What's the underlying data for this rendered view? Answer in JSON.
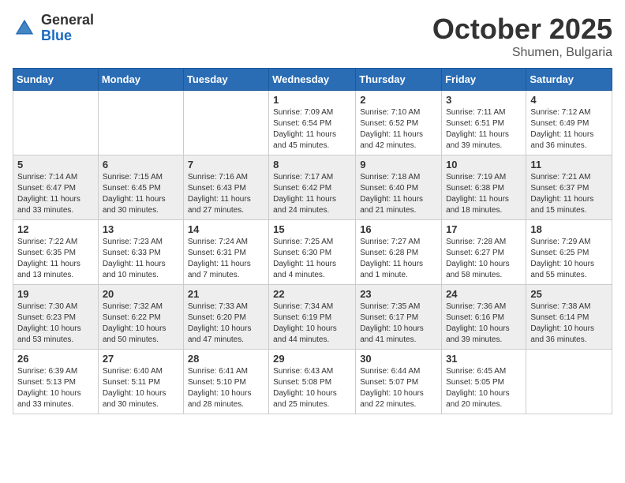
{
  "header": {
    "logo_general": "General",
    "logo_blue": "Blue",
    "month": "October 2025",
    "location": "Shumen, Bulgaria"
  },
  "days_of_week": [
    "Sunday",
    "Monday",
    "Tuesday",
    "Wednesday",
    "Thursday",
    "Friday",
    "Saturday"
  ],
  "weeks": [
    {
      "days": [
        {
          "number": "",
          "info": ""
        },
        {
          "number": "",
          "info": ""
        },
        {
          "number": "",
          "info": ""
        },
        {
          "number": "1",
          "info": "Sunrise: 7:09 AM\nSunset: 6:54 PM\nDaylight: 11 hours and 45 minutes."
        },
        {
          "number": "2",
          "info": "Sunrise: 7:10 AM\nSunset: 6:52 PM\nDaylight: 11 hours and 42 minutes."
        },
        {
          "number": "3",
          "info": "Sunrise: 7:11 AM\nSunset: 6:51 PM\nDaylight: 11 hours and 39 minutes."
        },
        {
          "number": "4",
          "info": "Sunrise: 7:12 AM\nSunset: 6:49 PM\nDaylight: 11 hours and 36 minutes."
        }
      ]
    },
    {
      "days": [
        {
          "number": "5",
          "info": "Sunrise: 7:14 AM\nSunset: 6:47 PM\nDaylight: 11 hours and 33 minutes."
        },
        {
          "number": "6",
          "info": "Sunrise: 7:15 AM\nSunset: 6:45 PM\nDaylight: 11 hours and 30 minutes."
        },
        {
          "number": "7",
          "info": "Sunrise: 7:16 AM\nSunset: 6:43 PM\nDaylight: 11 hours and 27 minutes."
        },
        {
          "number": "8",
          "info": "Sunrise: 7:17 AM\nSunset: 6:42 PM\nDaylight: 11 hours and 24 minutes."
        },
        {
          "number": "9",
          "info": "Sunrise: 7:18 AM\nSunset: 6:40 PM\nDaylight: 11 hours and 21 minutes."
        },
        {
          "number": "10",
          "info": "Sunrise: 7:19 AM\nSunset: 6:38 PM\nDaylight: 11 hours and 18 minutes."
        },
        {
          "number": "11",
          "info": "Sunrise: 7:21 AM\nSunset: 6:37 PM\nDaylight: 11 hours and 15 minutes."
        }
      ]
    },
    {
      "days": [
        {
          "number": "12",
          "info": "Sunrise: 7:22 AM\nSunset: 6:35 PM\nDaylight: 11 hours and 13 minutes."
        },
        {
          "number": "13",
          "info": "Sunrise: 7:23 AM\nSunset: 6:33 PM\nDaylight: 11 hours and 10 minutes."
        },
        {
          "number": "14",
          "info": "Sunrise: 7:24 AM\nSunset: 6:31 PM\nDaylight: 11 hours and 7 minutes."
        },
        {
          "number": "15",
          "info": "Sunrise: 7:25 AM\nSunset: 6:30 PM\nDaylight: 11 hours and 4 minutes."
        },
        {
          "number": "16",
          "info": "Sunrise: 7:27 AM\nSunset: 6:28 PM\nDaylight: 11 hours and 1 minute."
        },
        {
          "number": "17",
          "info": "Sunrise: 7:28 AM\nSunset: 6:27 PM\nDaylight: 10 hours and 58 minutes."
        },
        {
          "number": "18",
          "info": "Sunrise: 7:29 AM\nSunset: 6:25 PM\nDaylight: 10 hours and 55 minutes."
        }
      ]
    },
    {
      "days": [
        {
          "number": "19",
          "info": "Sunrise: 7:30 AM\nSunset: 6:23 PM\nDaylight: 10 hours and 53 minutes."
        },
        {
          "number": "20",
          "info": "Sunrise: 7:32 AM\nSunset: 6:22 PM\nDaylight: 10 hours and 50 minutes."
        },
        {
          "number": "21",
          "info": "Sunrise: 7:33 AM\nSunset: 6:20 PM\nDaylight: 10 hours and 47 minutes."
        },
        {
          "number": "22",
          "info": "Sunrise: 7:34 AM\nSunset: 6:19 PM\nDaylight: 10 hours and 44 minutes."
        },
        {
          "number": "23",
          "info": "Sunrise: 7:35 AM\nSunset: 6:17 PM\nDaylight: 10 hours and 41 minutes."
        },
        {
          "number": "24",
          "info": "Sunrise: 7:36 AM\nSunset: 6:16 PM\nDaylight: 10 hours and 39 minutes."
        },
        {
          "number": "25",
          "info": "Sunrise: 7:38 AM\nSunset: 6:14 PM\nDaylight: 10 hours and 36 minutes."
        }
      ]
    },
    {
      "days": [
        {
          "number": "26",
          "info": "Sunrise: 6:39 AM\nSunset: 5:13 PM\nDaylight: 10 hours and 33 minutes."
        },
        {
          "number": "27",
          "info": "Sunrise: 6:40 AM\nSunset: 5:11 PM\nDaylight: 10 hours and 30 minutes."
        },
        {
          "number": "28",
          "info": "Sunrise: 6:41 AM\nSunset: 5:10 PM\nDaylight: 10 hours and 28 minutes."
        },
        {
          "number": "29",
          "info": "Sunrise: 6:43 AM\nSunset: 5:08 PM\nDaylight: 10 hours and 25 minutes."
        },
        {
          "number": "30",
          "info": "Sunrise: 6:44 AM\nSunset: 5:07 PM\nDaylight: 10 hours and 22 minutes."
        },
        {
          "number": "31",
          "info": "Sunrise: 6:45 AM\nSunset: 5:05 PM\nDaylight: 10 hours and 20 minutes."
        },
        {
          "number": "",
          "info": ""
        }
      ]
    }
  ]
}
